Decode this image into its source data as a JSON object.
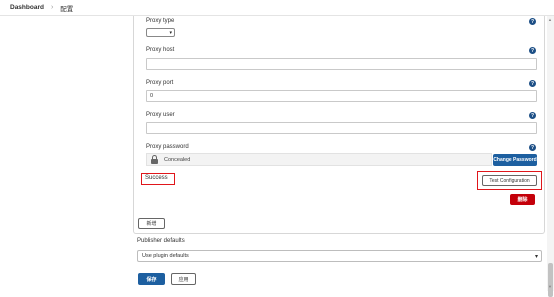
{
  "breadcrumb": {
    "item1": "Dashboard",
    "separator": "›",
    "item2": "配置"
  },
  "proxy": {
    "type_label": "Proxy type",
    "host_label": "Proxy host",
    "host_value": "",
    "port_label": "Proxy port",
    "port_value": "0",
    "user_label": "Proxy user",
    "user_value": "",
    "password_label": "Proxy password",
    "password_state": "Concealed",
    "change_password_label": "Change Password",
    "help_glyph": "?"
  },
  "test": {
    "status": "Success",
    "button_label": "Test Configuration"
  },
  "delete_label": "删除",
  "add_label": "新增",
  "publisher": {
    "label": "Publisher defaults",
    "selected": "Use plugin defaults"
  },
  "footer": {
    "save_label": "保存",
    "apply_label": "应用"
  },
  "colors": {
    "primary": "#1d5fa0",
    "danger": "#c4000a",
    "highlight_box": "#e0161b",
    "help_icon": "#1d4f86"
  }
}
